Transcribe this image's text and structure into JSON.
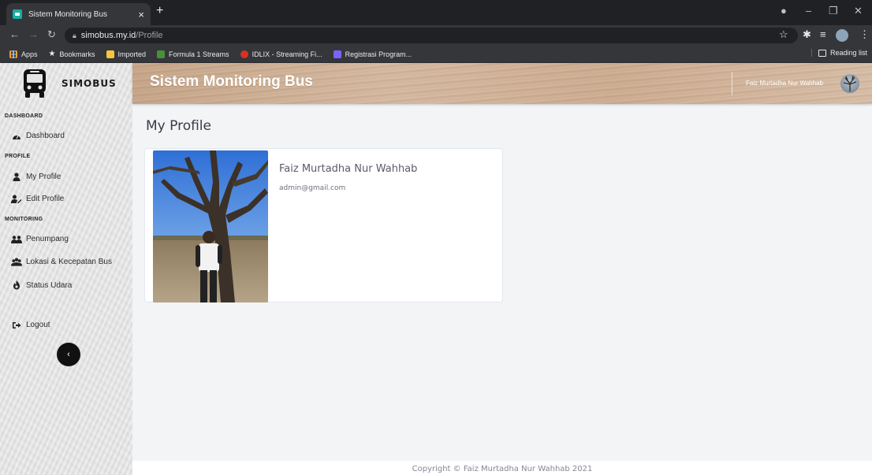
{
  "browser": {
    "tab_title": "Sistem Monitoring Bus",
    "tab_close": "×",
    "new_tab": "+",
    "url_host": "simobus.my.id",
    "url_path": "/Profile",
    "bookmarks": [
      {
        "label": "Apps",
        "icon": "apps-grid-icon",
        "color": "#e8a33c"
      },
      {
        "label": "Bookmarks",
        "icon": "star-icon",
        "color": "#e8eaed"
      },
      {
        "label": "Imported",
        "icon": "folder-icon",
        "color": "#f5c542"
      },
      {
        "label": "Formula 1 Streams",
        "icon": "f1-icon",
        "color": "#4a8f3a"
      },
      {
        "label": "IDLIX - Streaming Fi...",
        "icon": "idlix-icon",
        "color": "#d93025"
      },
      {
        "label": "Registrasi Program...",
        "icon": "form-icon",
        "color": "#7b61ff"
      }
    ],
    "reading_list": "Reading list"
  },
  "header": {
    "app_title": "Sistem Monitoring Bus",
    "user_name": "Faiz Murtadha Nur Wahhab"
  },
  "sidebar": {
    "brand": "SIMOBUS",
    "sections": [
      {
        "label": "DASHBOARD"
      },
      {
        "label": "PROFILE"
      },
      {
        "label": "MONITORING"
      }
    ],
    "items": [
      {
        "label": "Dashboard",
        "icon": "tachometer-icon"
      },
      {
        "label": "My Profile",
        "icon": "user-icon"
      },
      {
        "label": "Edit Profile",
        "icon": "user-edit-icon"
      },
      {
        "label": "Penumpang",
        "icon": "users-icon"
      },
      {
        "label": "Lokasi & Kecepatan Bus",
        "icon": "map-users-icon"
      },
      {
        "label": "Status Udara",
        "icon": "fire-icon"
      },
      {
        "label": "Logout",
        "icon": "sign-out-icon"
      }
    ],
    "collapse": "‹"
  },
  "main": {
    "page_title": "My Profile",
    "profile": {
      "name": "Faiz Murtadha Nur Wahhab",
      "email": "admin@gmail.com"
    }
  },
  "footer": {
    "copyright": "Copyright © Faiz Murtadha Nur Wahhab 2021"
  },
  "colors": {
    "accent_teal": "#17b0a4",
    "header_wood": "#d2b49a",
    "card_bg": "#ffffff",
    "page_bg": "#f2f4f6"
  }
}
